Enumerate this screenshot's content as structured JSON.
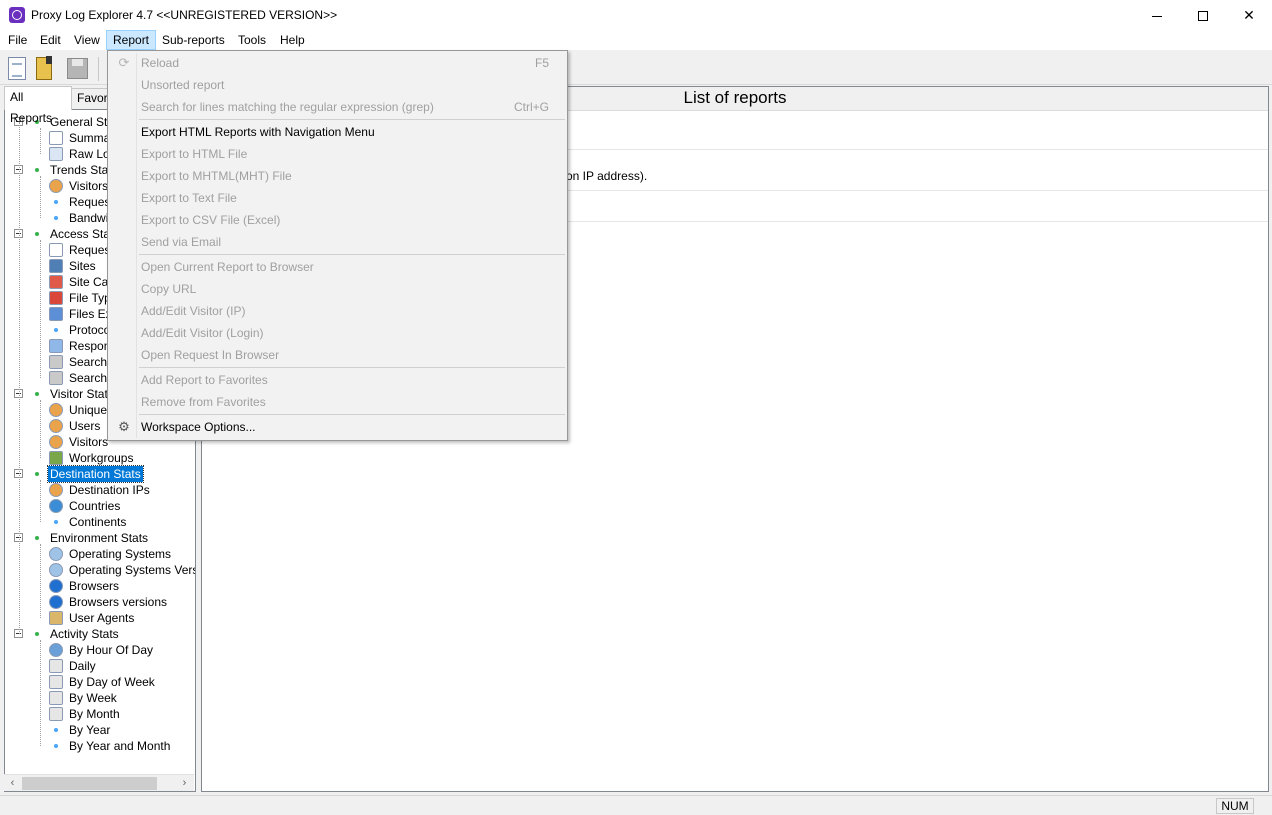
{
  "window": {
    "title": "Proxy Log Explorer 4.7 <<UNREGISTERED VERSION>>",
    "min": "—",
    "max": "☐",
    "close": "✕"
  },
  "menubar": [
    "File",
    "Edit",
    "View",
    "Report",
    "Sub-reports",
    "Tools",
    "Help"
  ],
  "toolbar": {
    "buttons": [
      "new-report-icon",
      "open-icon",
      "save-icon"
    ]
  },
  "left_tabs": [
    "All Reports",
    "Favorites"
  ],
  "tree": {
    "general": {
      "label": "General Stats",
      "children": [
        "Summary",
        "Raw Log"
      ]
    },
    "trends": {
      "label": "Trends Stats",
      "children": [
        "Visitors Trends",
        "Requests Trends",
        "Bandwidth Trends"
      ]
    },
    "access": {
      "label": "Access Stats",
      "children": [
        "Requests",
        "Sites",
        "Site Categories",
        "File Types",
        "Files Extensions",
        "Protocols",
        "Responses",
        "Search Engines",
        "Search Phrases"
      ]
    },
    "visitor": {
      "label": "Visitor Stats",
      "children": [
        "Unique Visitors",
        "Users",
        "Visitors",
        "Workgroups"
      ]
    },
    "destination": {
      "label": "Destination Stats",
      "children": [
        "Destination IPs",
        "Countries",
        "Continents"
      ]
    },
    "environment": {
      "label": "Environment Stats",
      "children": [
        "Operating Systems",
        "Operating Systems Versions",
        "Browsers",
        "Browsers versions",
        "User Agents"
      ]
    },
    "activity": {
      "label": "Activity Stats",
      "children": [
        "By Hour Of Day",
        "Daily",
        "By Day of Week",
        "By Week",
        "By Month",
        "By Year",
        "By Year and Month"
      ]
    }
  },
  "right_panel": {
    "header": "List of reports",
    "visible_fragment": "on IP address)."
  },
  "statusbar": {
    "num": "NUM"
  },
  "report_menu": {
    "items": [
      {
        "label": "Reload",
        "shortcut": "F5",
        "enabled": false,
        "icon": "reload-icon"
      },
      {
        "label": "Unsorted report",
        "shortcut": "",
        "enabled": false
      },
      {
        "label": "Search for lines matching the regular expression (grep)",
        "shortcut": "Ctrl+G",
        "enabled": false
      },
      {
        "label": "Export HTML Reports with Navigation Menu",
        "shortcut": "",
        "enabled": true
      },
      {
        "label": "Export to HTML File",
        "shortcut": "",
        "enabled": false
      },
      {
        "label": "Export to MHTML(MHT) File",
        "shortcut": "",
        "enabled": false
      },
      {
        "label": "Export to Text File",
        "shortcut": "",
        "enabled": false
      },
      {
        "label": "Export to CSV File (Excel)",
        "shortcut": "",
        "enabled": false
      },
      {
        "label": "Send via Email",
        "shortcut": "",
        "enabled": false
      },
      {
        "label": "Open Current Report to Browser",
        "shortcut": "",
        "enabled": false
      },
      {
        "label": "Copy URL",
        "shortcut": "",
        "enabled": false
      },
      {
        "label": "Add/Edit Visitor (IP)",
        "shortcut": "",
        "enabled": false
      },
      {
        "label": "Add/Edit Visitor (Login)",
        "shortcut": "",
        "enabled": false
      },
      {
        "label": "Open Request In Browser",
        "shortcut": "",
        "enabled": false
      },
      {
        "label": "Add Report to Favorites",
        "shortcut": "",
        "enabled": false
      },
      {
        "label": "Remove from Favorites",
        "shortcut": "",
        "enabled": false
      },
      {
        "label": "Workspace Options...",
        "shortcut": "",
        "enabled": true,
        "icon": "workspace-options-icon"
      }
    ]
  },
  "colors": {
    "selection": "#0078d7",
    "menu_active": "#cce8ff",
    "disabled_text": "#a0a0a0",
    "status_dot_green": "#37b34a",
    "status_dot_blue": "#4aa5ff"
  }
}
